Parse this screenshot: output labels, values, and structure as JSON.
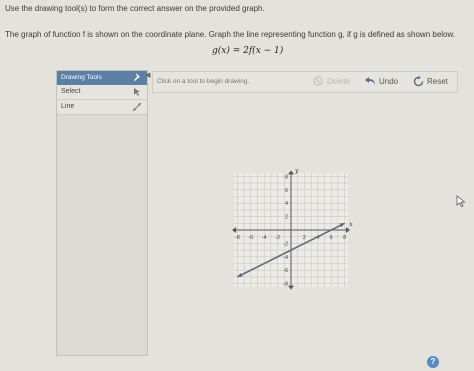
{
  "instructions": {
    "line1": "Use the drawing tool(s) to form the correct answer on the provided graph.",
    "line2": "The graph of function f is shown on the coordinate plane. Graph the line representing function g, if g is defined as shown below.",
    "formula": "g(x) = 2f(x − 1)"
  },
  "tools": {
    "header": "Drawing Tools",
    "items": [
      {
        "label": "Select",
        "icon": "select-icon"
      },
      {
        "label": "Line",
        "icon": "line-icon"
      }
    ]
  },
  "toolbar": {
    "hint": "Click on a tool to begin drawing.",
    "delete_label": "Delete",
    "undo_label": "Undo",
    "reset_label": "Reset"
  },
  "graph": {
    "x_axis_label": "x",
    "y_axis_label": "y",
    "x_range": [
      -8,
      8
    ],
    "y_range": [
      -8,
      8
    ],
    "x_ticks": [
      -8,
      -6,
      -4,
      -2,
      2,
      4,
      6,
      8
    ],
    "y_ticks": [
      8,
      6,
      4,
      2,
      -2,
      -4,
      -6,
      -8
    ],
    "grid": true,
    "function_f": {
      "x1": -8,
      "y1": -7,
      "x2": 8,
      "y2": 1,
      "color": "#5f6a7a"
    }
  },
  "colors": {
    "header_bg": "#5c7fa5",
    "help": "#5b8ac2"
  }
}
